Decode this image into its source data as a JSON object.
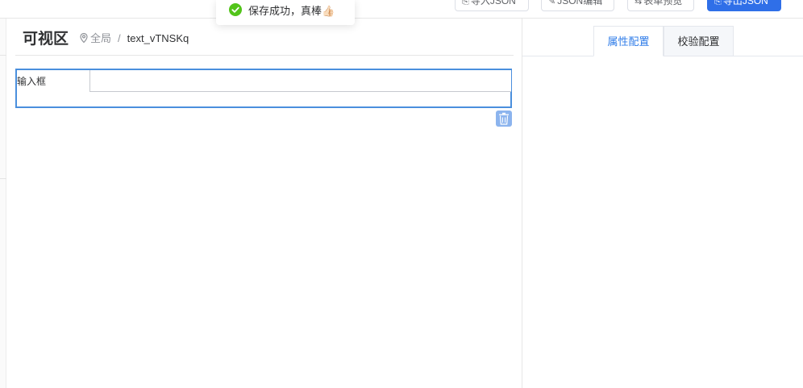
{
  "toolbar": {
    "import_json_label": "导入JSON",
    "json_edit_label": "JSON编辑",
    "form_preview_label": "表单预览",
    "export_json_label": "导出JSON"
  },
  "canvas": {
    "title": "可视区",
    "breadcrumb_scope": "全局",
    "breadcrumb_separator": "/",
    "selected_field_id": "text_vTNSKq"
  },
  "form_field": {
    "label": "输入框",
    "value": ""
  },
  "config_panel": {
    "tabs": [
      {
        "label": "属性配置",
        "active": true
      },
      {
        "label": "校验配置",
        "active": false
      }
    ]
  },
  "toast": {
    "message": "保存成功，真棒👍🏻",
    "type": "success"
  },
  "colors": {
    "primary": "#2f6fe8",
    "active_tab": "#2f7ce8",
    "selection_border": "#4a8fdd",
    "success": "#52c41a"
  }
}
